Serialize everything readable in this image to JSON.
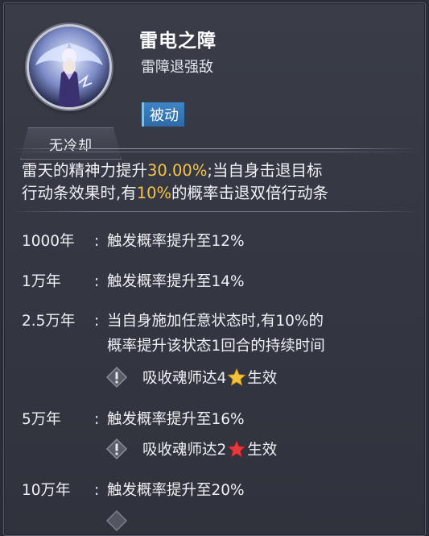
{
  "skill": {
    "name": "雷电之障",
    "subtitle": "雷障退强敌",
    "cooldown_label": "无冷却",
    "type_tag": "被动",
    "description": {
      "line1_prefix": "雷天的精神力提升",
      "line1_value": "30.00%",
      "line1_suffix": ";当自身击退目标",
      "line2_prefix": "行动条效果时,有",
      "line2_value": "10%",
      "line2_suffix": "的概率击退双倍行动条"
    }
  },
  "tiers": [
    {
      "level": "1000年",
      "colon": ":",
      "text": "触发概率提升至12%"
    },
    {
      "level": "1万年",
      "colon": ":",
      "text": "触发概率提升至14%"
    },
    {
      "level": "2.5万年",
      "colon": ":",
      "text": "当自身施加任意状态时,有10%的",
      "text2": "概率提升该状态1回合的持续时间",
      "req_prefix": "吸收魂师达4",
      "req_suffix": "生效",
      "star_color": "#f2c23a"
    },
    {
      "level": "5万年",
      "colon": ":",
      "text": "触发概率提升至16%",
      "req_prefix": "吸收魂师达2",
      "req_suffix": "生效",
      "star_color": "#e5393d"
    },
    {
      "level": "10万年",
      "colon": ":",
      "text": "触发概率提升至20%"
    }
  ],
  "icons": {
    "warning": "warning-icon",
    "star": "star-icon"
  }
}
